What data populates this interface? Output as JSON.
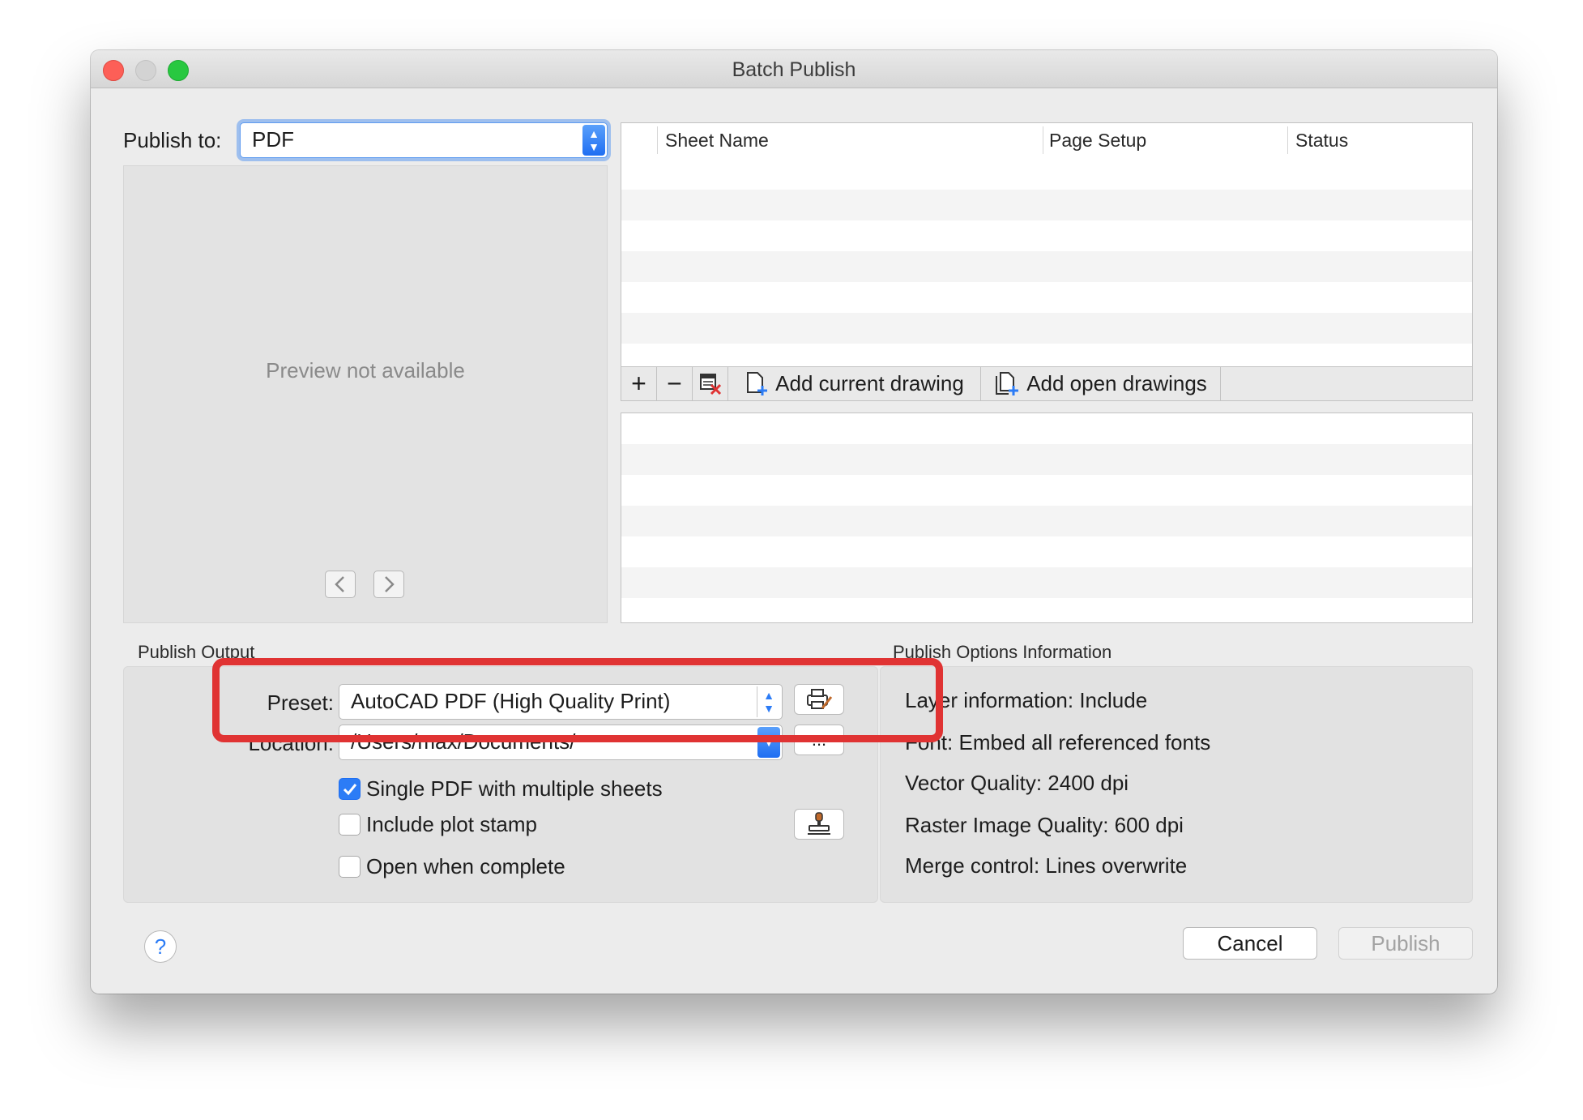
{
  "window": {
    "title": "Batch Publish"
  },
  "publish_to": {
    "label": "Publish to:",
    "value": "PDF"
  },
  "preview": {
    "message": "Preview not available",
    "prev_icon": "chevron-left-icon",
    "next_icon": "chevron-right-icon"
  },
  "sheet_table": {
    "columns": [
      "Sheet Name",
      "Page Setup",
      "Status"
    ],
    "rows": []
  },
  "toolbar": {
    "add_icon": "+",
    "remove_icon": "−",
    "add_current_label": "Add current drawing",
    "add_open_label": "Add open drawings"
  },
  "publish_output": {
    "title": "Publish Output",
    "preset_label": "Preset:",
    "preset_value": "AutoCAD PDF (High Quality Print)",
    "location_label": "Location:",
    "location_value": "/Users/max/Documents/",
    "browse_label": "...",
    "single_pdf_label": "Single PDF with multiple sheets",
    "single_pdf_checked": true,
    "plot_stamp_label": "Include plot stamp",
    "plot_stamp_checked": false,
    "open_complete_label": "Open when complete",
    "open_complete_checked": false
  },
  "publish_options": {
    "title": "Publish Options Information",
    "items": [
      "Layer information: Include",
      "Font: Embed all referenced fonts",
      "Vector Quality: 2400 dpi",
      "Raster Image Quality: 600 dpi",
      "Merge control: Lines overwrite"
    ]
  },
  "footer": {
    "help_label": "?",
    "cancel_label": "Cancel",
    "publish_label": "Publish"
  },
  "colors": {
    "accent": "#2c7cf6",
    "highlight": "#e03333"
  }
}
